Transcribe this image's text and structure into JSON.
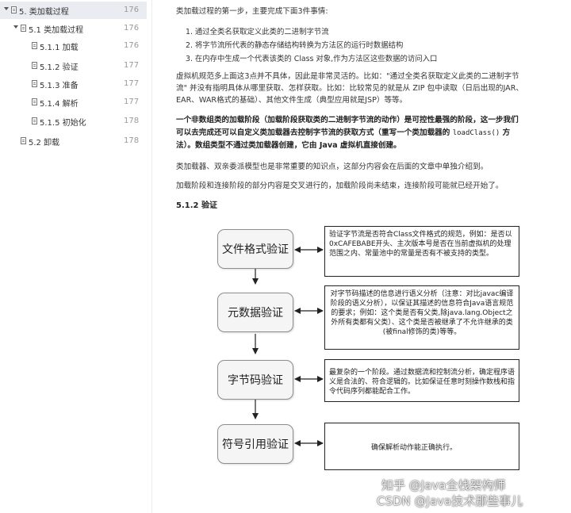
{
  "toc": [
    {
      "label": "5. 类加载过程",
      "page": "176",
      "level": 0,
      "active": true,
      "expanded": true
    },
    {
      "label": "5.1 类加载过程",
      "page": "176",
      "level": 1,
      "active": false,
      "expanded": true
    },
    {
      "label": "5.1.1 加载",
      "page": "176",
      "level": 2,
      "active": false
    },
    {
      "label": "5.1.2 验证",
      "page": "177",
      "level": 2,
      "active": false
    },
    {
      "label": "5.1.3 准备",
      "page": "177",
      "level": 2,
      "active": false
    },
    {
      "label": "5.1.4 解析",
      "page": "177",
      "level": 2,
      "active": false
    },
    {
      "label": "5.1.5 初始化",
      "page": "178",
      "level": 2,
      "active": false
    },
    {
      "label": "5.2 卸载",
      "page": "178",
      "level": 1,
      "active": false
    }
  ],
  "article": {
    "intro": "类加载过程的第一步，主要完成下面3件事情:",
    "steps": [
      "1. 通过全类名获取定义此类的二进制字节流",
      "2. 将字节流所代表的静态存储结构转换为方法区的运行时数据结构",
      "3. 在内存中生成一个代表该类的 Class 对象,作为方法区这些数据的访问入口"
    ],
    "para1_line1": "虚拟机规范多上面这3点并不具体，因此是非常灵活的。比如：\"通过全类名获取定义此类的二进制字节",
    "para1_line2": "流\" 并没有指明具体从哪里获取、怎样获取。比如：比较常见的就是从 ZIP 包中读取（日后出现的JAR、",
    "para1_line3": "EAR、WAR格式的基础）、其他文件生成（典型应用就是JSP）等等。",
    "bold_line1": "一个非数组类的加载阶段（加载阶段获取类的二进制字节流的动作）是可控性最强的阶段，这一步我们",
    "bold_line2": "可以去完成还可以自定义类加载器去控制字节流的获取方式（重写一个类加载器的",
    "bold_code": "loadClass()",
    "bold_line2_end": "方",
    "bold_line3": "法）。数组类型不通过类加载器创建，它由 Java 虚拟机直接创建。",
    "para3": "类加载器、双亲委派模型也是非常重要的知识点，这部分内容会在后面的文章中单独介绍到。",
    "para4": "加载阶段和连接阶段的部分内容是交叉进行的，加载阶段尚未结束，连接阶段可能就已经开始了。",
    "section_heading": "5.1.2 验证"
  },
  "diagram": {
    "stages": [
      {
        "label": "文件格式验证",
        "description": "验证字节流是否符合Class文件格式的规范，例如：是否以0xCAFEBABE开头、主次版本号是否在当前虚拟机的处理范围之内、常量池中的常量是否有不被支持的类型。"
      },
      {
        "label": "元数据验证",
        "description": "对字节码描述的信息进行语义分析（注意：对比javac编译阶段的语义分析），以保证其描述的信息符合Java语言规范的要求；例如：这个类是否有父类,除java.lang.Object之外所有类都有父类）、这个类是否被继承了不允许继承的类(被final修饰的类)等等。"
      },
      {
        "label": "字节码验证",
        "description": "最复杂的一个阶段。通过数据流和控制流分析，确定程序语义是合法的、符合逻辑的。比如保证任意时刻操作数栈和指令代码序列都能配合工作。"
      },
      {
        "label": "符号引用验证",
        "description": "确保解析动作能正确执行。"
      }
    ]
  },
  "watermarks": {
    "zhihu": "知乎 @Java全栈架构师",
    "csdn": "CSDN @Java技术那些事儿"
  },
  "colors": {
    "toc_active_bg": "#e9ecf1",
    "stage_bg": "#f5f5f5",
    "text": "#333333"
  }
}
